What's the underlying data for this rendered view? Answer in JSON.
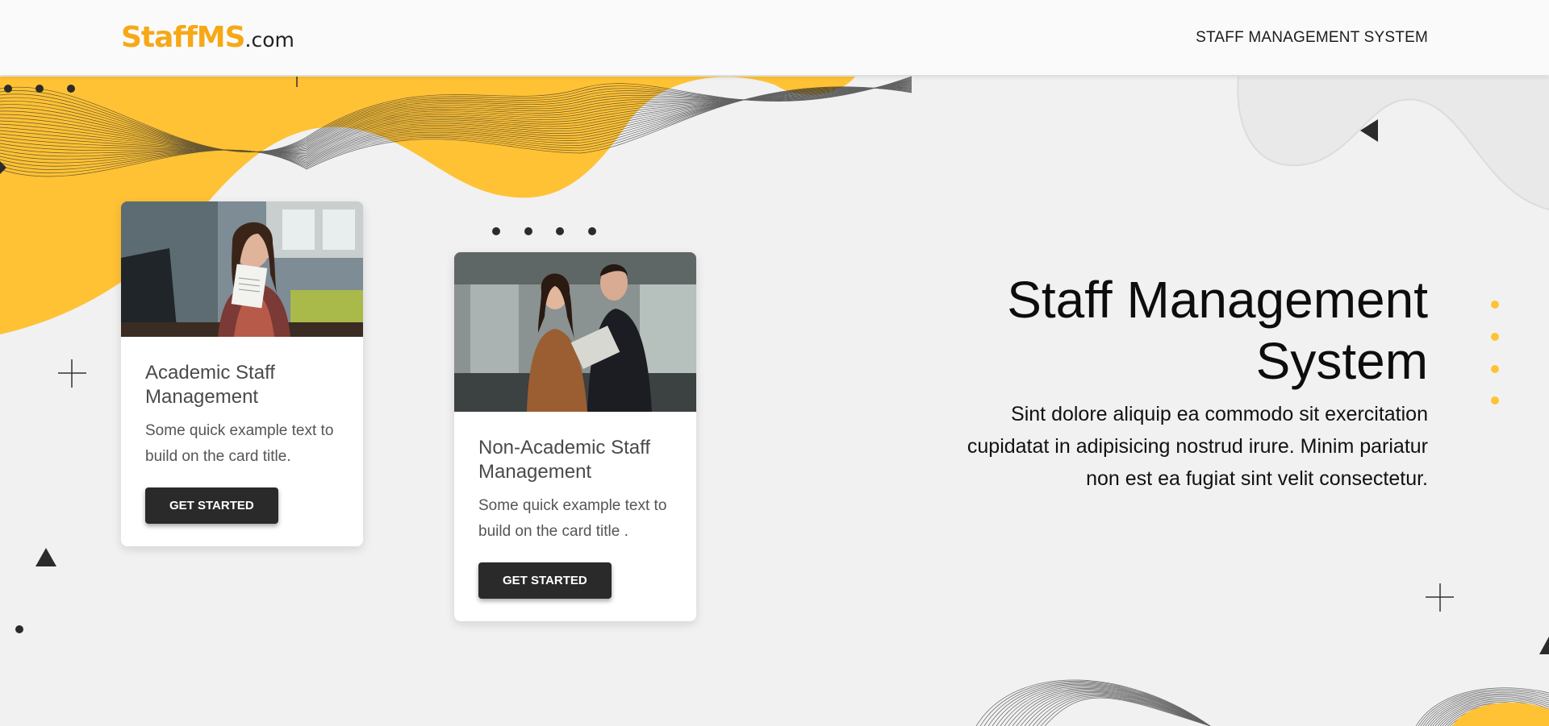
{
  "navbar": {
    "brand_strong": "StaffMS",
    "brand_tld": ".com",
    "title": "STAFF MANAGEMENT SYSTEM"
  },
  "cards": [
    {
      "title": "Academic Staff Management",
      "text": "Some quick example text to build on the card title.",
      "button": "GET STARTED",
      "image_icon": "photo-woman-headset-icon"
    },
    {
      "title": "Non-Academic Staff Management",
      "text": "Some quick example text to build on the card title .",
      "button": "GET STARTED",
      "image_icon": "photo-business-couple-icon"
    }
  ],
  "hero": {
    "title": "Staff Management System",
    "text": "Sint dolore aliquip ea commodo sit exercitation cupidatat in adipisicing nostrud irure. Minim pariatur non est ea fugiat sint velit consectetur."
  },
  "colors": {
    "accent": "#f6a816",
    "yellow_wave": "#ffc234",
    "background": "#f1f1f1",
    "button": "#2a2a2a"
  }
}
